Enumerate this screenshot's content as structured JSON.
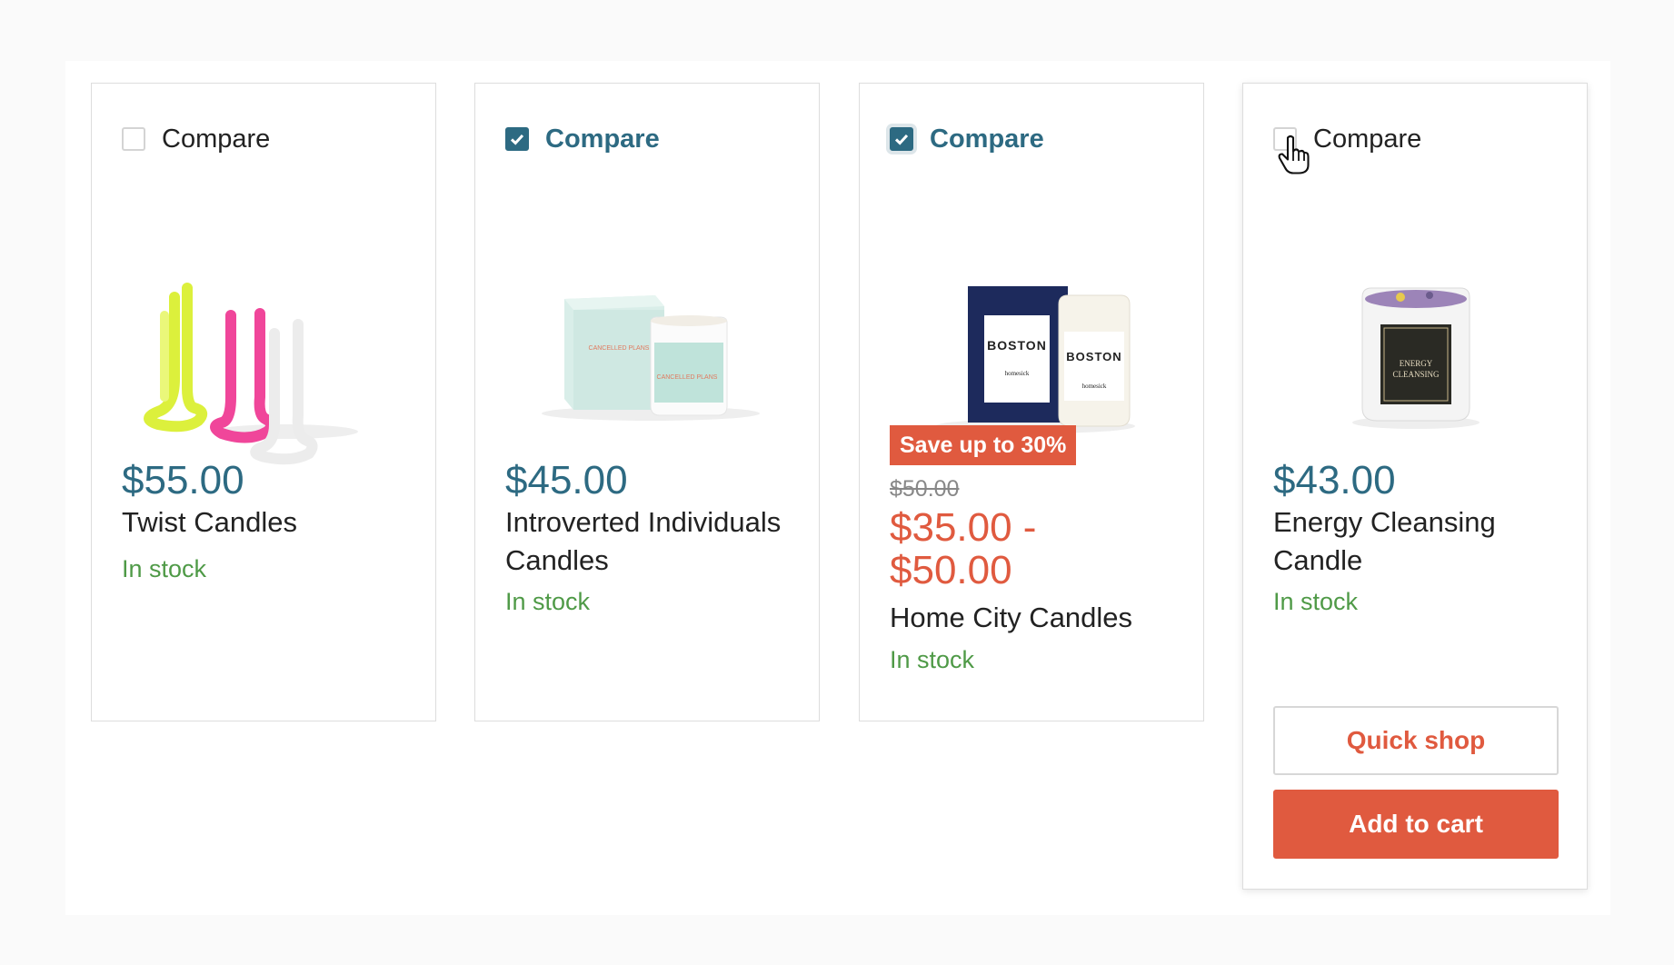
{
  "colors": {
    "accent": "#2d6a82",
    "sale": "#e05a3f",
    "in_stock": "#4f9a47",
    "text": "#222222"
  },
  "products": [
    {
      "compare_label": "Compare",
      "compare_checked": false,
      "image_icon": "twist-candles-image",
      "price": "$55.00",
      "title": "Twist Candles",
      "stock": "In stock"
    },
    {
      "compare_label": "Compare",
      "compare_checked": true,
      "image_icon": "introverted-candle-image",
      "image_text": "CANCELLED PLANS",
      "price": "$45.00",
      "title": "Introverted Individuals Candles",
      "stock": "In stock"
    },
    {
      "compare_label": "Compare",
      "compare_checked": true,
      "image_icon": "boston-candle-image",
      "image_text": [
        "BOSTON",
        "homesick"
      ],
      "badge": "Save up to 30%",
      "compare_at_price": "$50.00",
      "price": "$35.00 - $50.00",
      "title": "Home City Candles",
      "stock": "In stock"
    },
    {
      "compare_label": "Compare",
      "compare_checked": false,
      "image_icon": "energy-cleansing-candle-image",
      "image_text": [
        "ENERGY",
        "CLEANSING"
      ],
      "price": "$43.00",
      "title": "Energy Cleansing Candle",
      "stock": "In stock",
      "quick_shop_label": "Quick shop",
      "add_to_cart_label": "Add to cart"
    }
  ]
}
